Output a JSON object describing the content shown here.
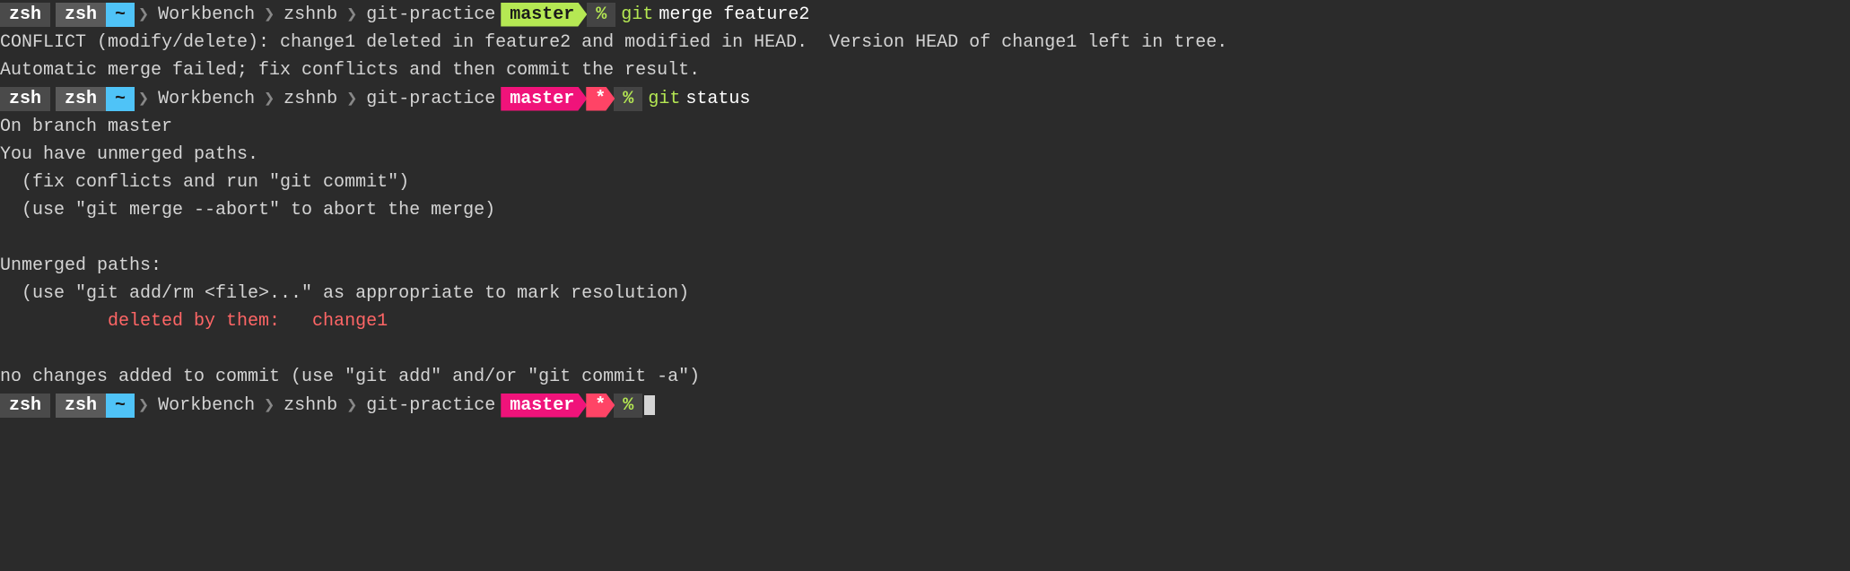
{
  "terminal": {
    "bg": "#2b2b2b",
    "lines": [
      {
        "type": "prompt",
        "prompt_type": "clean",
        "branch": "master",
        "branch_color": "green",
        "command": "git merge feature2"
      },
      {
        "type": "output",
        "text": "CONFLICT (modify/delete): change1 deleted in feature2 and modified in HEAD.  Version HEAD of change1 left in tree."
      },
      {
        "type": "output",
        "text": "Automatic merge failed; fix conflicts and then commit the result."
      },
      {
        "type": "prompt",
        "prompt_type": "conflict",
        "branch": "master",
        "branch_color": "pink",
        "command": "git status"
      },
      {
        "type": "output",
        "text": "On branch master"
      },
      {
        "type": "output",
        "text": "You have unmerged paths."
      },
      {
        "type": "output",
        "text": "  (fix conflicts and run \"git commit\")"
      },
      {
        "type": "output",
        "text": "  (use \"git merge --abort\" to abort the merge)"
      },
      {
        "type": "output",
        "text": ""
      },
      {
        "type": "output",
        "text": "Unmerged paths:"
      },
      {
        "type": "output",
        "text": "  (use \"git add/rm <file>...\" as appropriate to mark resolution)"
      },
      {
        "type": "output_red",
        "text": "\t  deleted by them:   change1"
      },
      {
        "type": "output",
        "text": ""
      },
      {
        "type": "output",
        "text": "no changes added to commit (use \"git add\" and/or \"git commit -a\")"
      },
      {
        "type": "prompt_cursor",
        "prompt_type": "conflict",
        "branch": "master",
        "branch_color": "pink"
      }
    ],
    "labels": {
      "zsh1": "zsh",
      "zsh2": "zsh",
      "tilde": "~",
      "workbench": "Workbench",
      "zshnb": "zshnb",
      "git_practice": "git-practice",
      "master": "master",
      "star": "*",
      "percent": "%",
      "git_cmd": "git",
      "tree_word": "tree"
    }
  }
}
